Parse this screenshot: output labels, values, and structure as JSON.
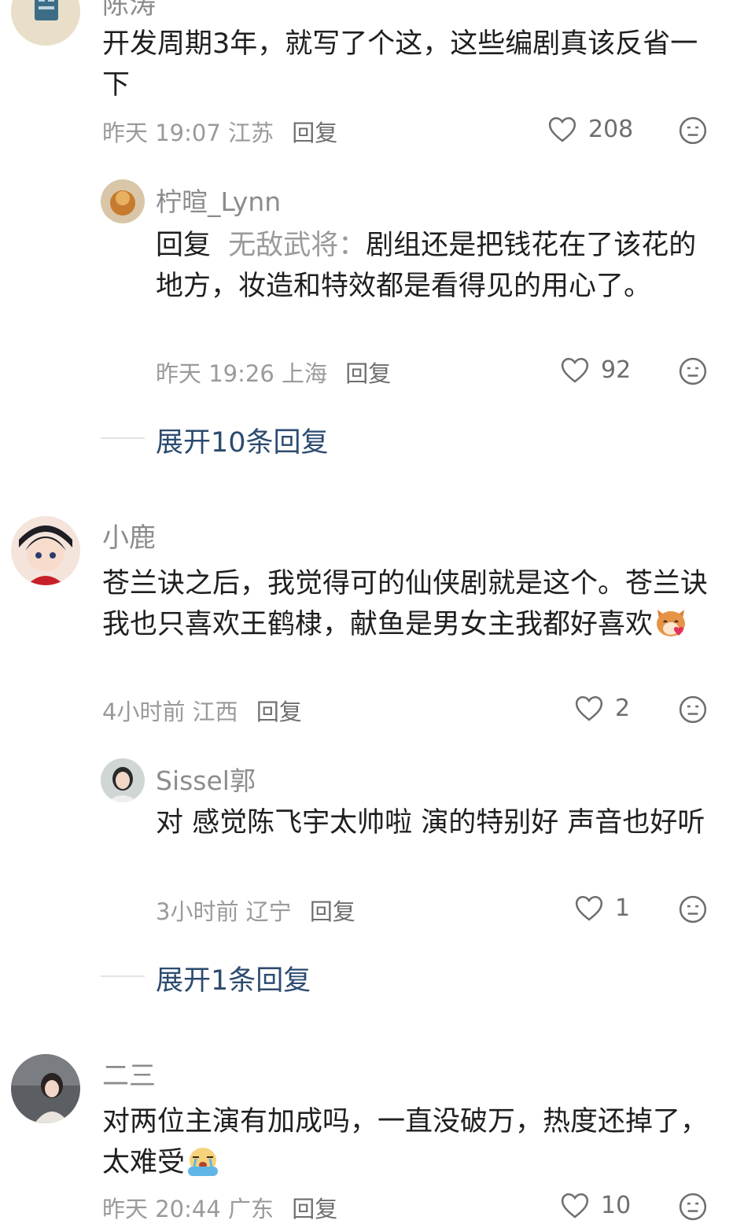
{
  "comments": [
    {
      "username": "陈涛",
      "content": "开发周期3年，就写了个这，这些编剧真该反省一下",
      "meta": "昨天 19:07 江苏",
      "reply_label": "回复",
      "likes": "208",
      "replies": [
        {
          "username": "柠暄_Lynn",
          "reply_prefix": "回复",
          "mention": "无敌武将：",
          "content": "剧组还是把钱花在了该花的地方，妆造和特效都是看得见的用心了。",
          "meta": "昨天 19:26 上海",
          "reply_label": "回复",
          "likes": "92"
        }
      ],
      "expand_label": "展开10条回复"
    },
    {
      "username": "小鹿",
      "content": "苍兰诀之后，我觉得可的仙侠剧就是这个。苍兰诀我也只喜欢王鹤棣，献鱼是男女主我都好喜欢",
      "emoji": "cat-heart-emoji",
      "meta": "4小时前 江西",
      "reply_label": "回复",
      "likes": "2",
      "replies": [
        {
          "username": "Sissel郭",
          "content": "对 感觉陈飞宇太帅啦 演的特别好 声音也好听",
          "meta": "3小时前 辽宁",
          "reply_label": "回复",
          "likes": "1"
        }
      ],
      "expand_label": "展开1条回复"
    },
    {
      "username": "二三",
      "content": "对两位主演有加成吗，一直没破万，热度还掉了，太难受",
      "emoji": "crying-emoji",
      "meta": "昨天 20:44 广东",
      "reply_label": "回复",
      "likes": "10"
    }
  ],
  "icons": {
    "like": "heart-outline-icon",
    "dislike": "dislike-face-icon"
  },
  "colors": {
    "link": "#2c4b6f",
    "muted": "#9a9a9a",
    "text": "#1f1f1f"
  }
}
